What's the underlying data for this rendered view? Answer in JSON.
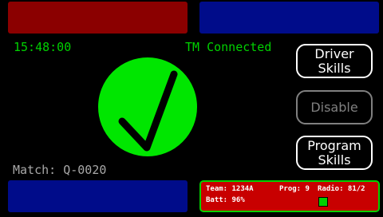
{
  "header": {
    "clock": "15:48:00",
    "tm_status": "TM Connected"
  },
  "status": {
    "match": "Match: Q-0020",
    "indicator_icon": "checkmark-icon",
    "indicator_color": "#00e600"
  },
  "buttons": {
    "driver_skills": "Driver\nSkills",
    "disable": "Disable",
    "program_skills": "Program\nSkills"
  },
  "stats": {
    "team": "Team: 1234A",
    "prog": "Prog: 9",
    "radio": "Radio: 81/2",
    "batt": "Batt: 96%",
    "led_color": "#00d100"
  },
  "colors": {
    "red_panel": "#8b0000",
    "blue_panel": "#000c8a",
    "accent_green": "#00d100"
  }
}
